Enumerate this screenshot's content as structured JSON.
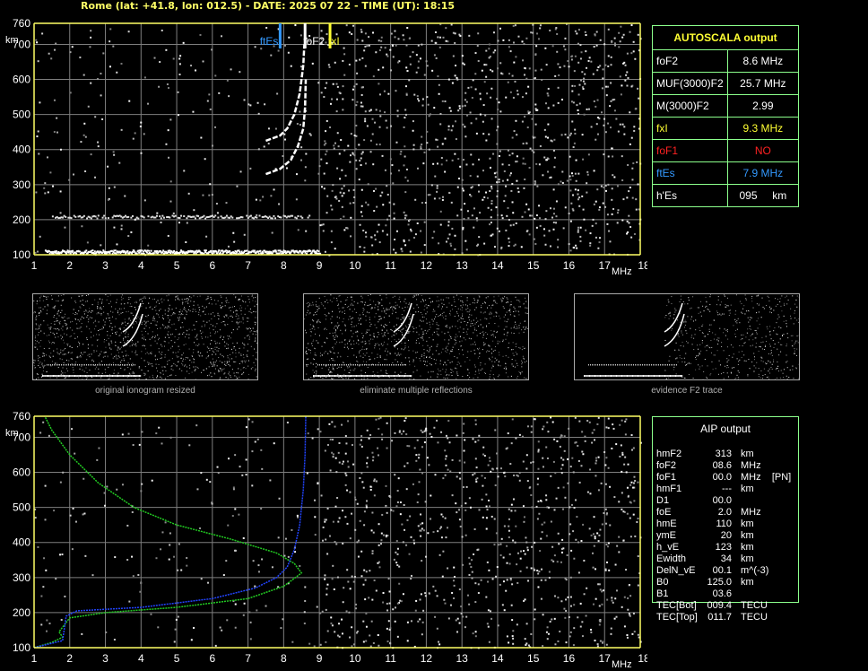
{
  "header": {
    "title": "Rome (lat: +41.8, lon: 012.5) - DATE: 2025 07 22 - TIME (UT): 18:15"
  },
  "colors": {
    "panel_border": "#8cff8c",
    "axis": "#ffff66",
    "grid": "#7f7f7f",
    "fxI": "#ffff33",
    "foF1": "#ff2222",
    "ftEs": "#3399ff",
    "profile_green": "#22cc22",
    "profile_blue": "#2244ff",
    "trace": "#ffffff"
  },
  "autoscala": {
    "title": "AUTOSCALA output",
    "rows": [
      {
        "name": "foF2",
        "value": "8.6 MHz",
        "color": "#ffffff"
      },
      {
        "name": "MUF(3000)F2",
        "value": "25.7 MHz",
        "color": "#ffffff"
      },
      {
        "name": "M(3000)F2",
        "value": "2.99",
        "color": "#ffffff"
      },
      {
        "name": "fxI",
        "value": "9.3 MHz",
        "color": "#ffff33"
      },
      {
        "name": "foF1",
        "value": "NO",
        "color": "#ff2222"
      },
      {
        "name": "ftEs",
        "value": "7.9 MHz",
        "color": "#3399ff"
      },
      {
        "name": "h'Es",
        "value": "095     km",
        "color": "#ffffff"
      }
    ]
  },
  "aip": {
    "title": "AIP output",
    "rows": [
      {
        "name": "hmF2",
        "value": "313",
        "unit": "km"
      },
      {
        "name": "foF2",
        "value": "08.6",
        "unit": "MHz"
      },
      {
        "name": "foF1",
        "value": "00.0",
        "unit": "MHz    [PN]"
      },
      {
        "name": "hmF1",
        "value": "---",
        "unit": "km"
      },
      {
        "name": "D1",
        "value": "00.0",
        "unit": ""
      },
      {
        "name": "foE",
        "value": "2.0",
        "unit": "MHz"
      },
      {
        "name": "hmE",
        "value": "110",
        "unit": "km"
      },
      {
        "name": "ymE",
        "value": "20",
        "unit": "km"
      },
      {
        "name": "h_vE",
        "value": "123",
        "unit": "km"
      },
      {
        "name": "Ewidth",
        "value": "34",
        "unit": "km"
      },
      {
        "name": "DelN_vE",
        "value": "00.1",
        "unit": "m^(-3)"
      },
      {
        "name": "B0",
        "value": "125.0",
        "unit": "km"
      },
      {
        "name": "B1",
        "value": "03.6",
        "unit": ""
      },
      {
        "name": "TEC[Bot]",
        "value": "009.4",
        "unit": "TECU"
      },
      {
        "name": "TEC[Top]",
        "value": "011.7",
        "unit": "TECU"
      }
    ]
  },
  "captions": {
    "thumb1": "original ionogram resized",
    "thumb2": "eliminate multiple reflections",
    "thumb3": "evidence F2 trace"
  },
  "chart_data": [
    {
      "type": "scatter",
      "name": "ionogram-top",
      "xlabel": "MHz",
      "ylabel": "km",
      "xlim": [
        1,
        18
      ],
      "ylim": [
        100,
        760
      ],
      "x_ticks": [
        1,
        2,
        3,
        4,
        5,
        6,
        7,
        8,
        9,
        10,
        11,
        12,
        13,
        14,
        15,
        16,
        17,
        18
      ],
      "y_ticks": [
        100,
        200,
        300,
        400,
        500,
        600,
        700,
        760
      ],
      "grid": true,
      "markers": [
        {
          "label": "ftEs",
          "x": 7.9,
          "color": "#3399ff"
        },
        {
          "label": "foF2",
          "x": 8.6,
          "color": "#ffffff"
        },
        {
          "label": "fxI",
          "x": 9.3,
          "color": "#ffff33"
        }
      ],
      "traces": {
        "es_layer": {
          "h": 110,
          "x": [
            1.3,
            9.0
          ]
        },
        "es_second": {
          "h": 210,
          "x": [
            1.5,
            8.7
          ]
        },
        "o_trace": [
          [
            7.5,
            330
          ],
          [
            7.9,
            345
          ],
          [
            8.2,
            370
          ],
          [
            8.4,
            410
          ],
          [
            8.55,
            460
          ],
          [
            8.6,
            520
          ],
          [
            8.62,
            600
          ]
        ],
        "x_trace": [
          [
            7.5,
            425
          ],
          [
            7.9,
            440
          ],
          [
            8.1,
            460
          ],
          [
            8.3,
            500
          ],
          [
            8.45,
            560
          ],
          [
            8.55,
            640
          ],
          [
            8.58,
            700
          ]
        ]
      }
    },
    {
      "type": "line",
      "name": "ionogram-bottom",
      "xlabel": "MHz",
      "ylabel": "km",
      "xlim": [
        1,
        18
      ],
      "ylim": [
        100,
        760
      ],
      "x_ticks": [
        1,
        2,
        3,
        4,
        5,
        6,
        7,
        8,
        9,
        10,
        11,
        12,
        13,
        14,
        15,
        16,
        17,
        18
      ],
      "y_ticks": [
        100,
        200,
        300,
        400,
        500,
        600,
        700,
        760
      ],
      "grid": true,
      "series": [
        {
          "color": "#22cc22",
          "points": [
            [
              1.0,
              100
            ],
            [
              1.5,
              115
            ],
            [
              1.8,
              130
            ],
            [
              1.7,
              145
            ],
            [
              2.0,
              185
            ],
            [
              3.0,
              200
            ],
            [
              5.0,
              215
            ],
            [
              7.0,
              240
            ],
            [
              8.0,
              275
            ],
            [
              8.5,
              313
            ],
            [
              8.3,
              340
            ],
            [
              7.8,
              370
            ],
            [
              6.5,
              410
            ],
            [
              5.0,
              450
            ],
            [
              3.8,
              500
            ],
            [
              2.8,
              570
            ],
            [
              2.0,
              650
            ],
            [
              1.5,
              720
            ],
            [
              1.3,
              760
            ]
          ]
        },
        {
          "color": "#2244ff",
          "points": [
            [
              1.0,
              100
            ],
            [
              1.8,
              120
            ],
            [
              1.9,
              190
            ],
            [
              2.2,
              205
            ],
            [
              4.0,
              215
            ],
            [
              6.0,
              240
            ],
            [
              7.2,
              270
            ],
            [
              7.8,
              300
            ],
            [
              8.1,
              330
            ],
            [
              8.3,
              380
            ],
            [
              8.45,
              450
            ],
            [
              8.55,
              550
            ],
            [
              8.6,
              650
            ],
            [
              8.62,
              760
            ]
          ]
        }
      ]
    }
  ]
}
